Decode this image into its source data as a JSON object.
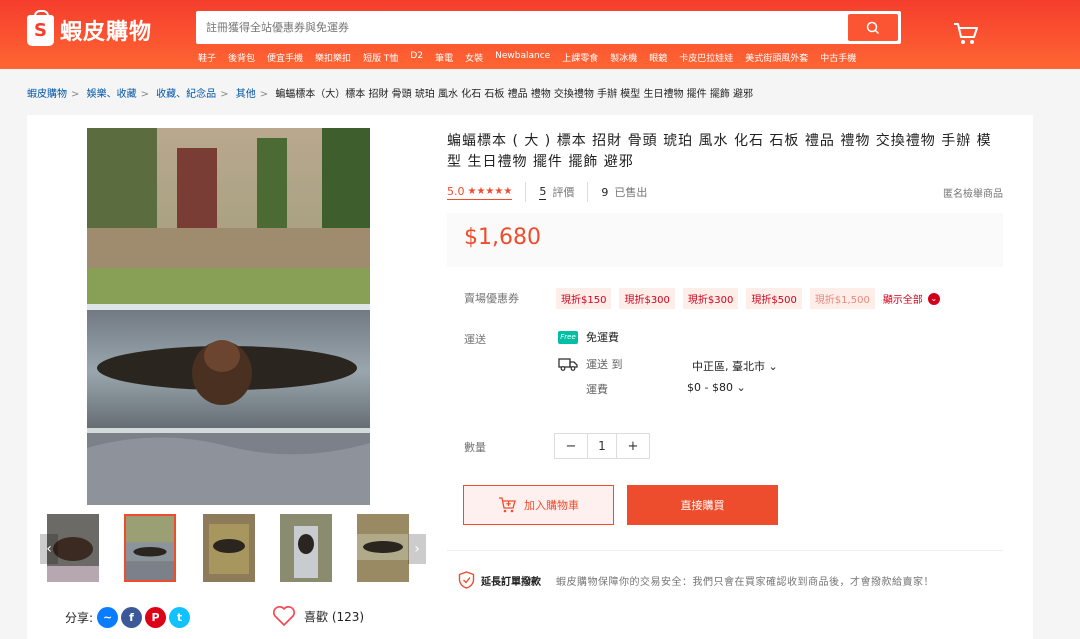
{
  "header": {
    "logo_text": "蝦皮購物",
    "logo_letter": "S",
    "search_placeholder": "註冊獲得全站優惠券與免運券",
    "hotwords": [
      "鞋子",
      "後背包",
      "便宜手機",
      "樂扣樂扣",
      "短版 T恤",
      "D2",
      "筆電",
      "女裝",
      "Newbalance",
      "上課零食",
      "製冰機",
      "眼鏡",
      "卡皮巴拉娃娃",
      "美式街頭風外套",
      "中古手機"
    ]
  },
  "breadcrumb": {
    "items": [
      "蝦皮購物",
      "娛樂、收藏",
      "收藏、紀念品",
      "其他"
    ],
    "current": "蝙蝠標本（大）標本 招財 骨頭 琥珀 風水 化石 石板 禮品 禮物 交換禮物 手辦 模型 生日禮物 擺件 擺飾 避邪"
  },
  "product": {
    "title": "蝙蝠標本 ( 大 ) 標本 招財 骨頭 琥珀 風水 化石 石板 禮品 禮物 交換禮物 手辦 模型 生日禮物 擺件 擺飾 避邪",
    "rating": "5.0",
    "stars": "★★★★★",
    "review_count": "5",
    "review_label": "評價",
    "sold_count": "9",
    "sold_label": "已售出",
    "report_label": "匿名檢舉商品",
    "price": "$1,680"
  },
  "vouchers": {
    "label": "賣場優惠券",
    "items": [
      "現折$150",
      "現折$300",
      "現折$300",
      "現折$500",
      "現折$1,500"
    ],
    "show_all": "顯示全部"
  },
  "shipping": {
    "label": "運送",
    "free_badge": "Free",
    "free_text": "免運費",
    "ship_to_label": "運送 到",
    "destination": "中正區, 臺北市",
    "fee_label": "運費",
    "fee_range": "$0 - $80"
  },
  "quantity": {
    "label": "數量",
    "minus": "−",
    "value": "1",
    "plus": "+"
  },
  "actions": {
    "add_to_cart": "加入購物車",
    "buy_now": "直接購買"
  },
  "guarantee": {
    "title": "延長訂單撥款",
    "text": "蝦皮購物保障你的交易安全：我們只會在買家確認收到商品後，才會撥款給賣家！"
  },
  "social": {
    "share_label": "分享:",
    "like_label": "喜歡 (123)"
  },
  "colors": {
    "brand": "#ee4d2d",
    "header": "#f53d2d",
    "free_ship": "#00bfa5",
    "link": "#0055aa"
  }
}
